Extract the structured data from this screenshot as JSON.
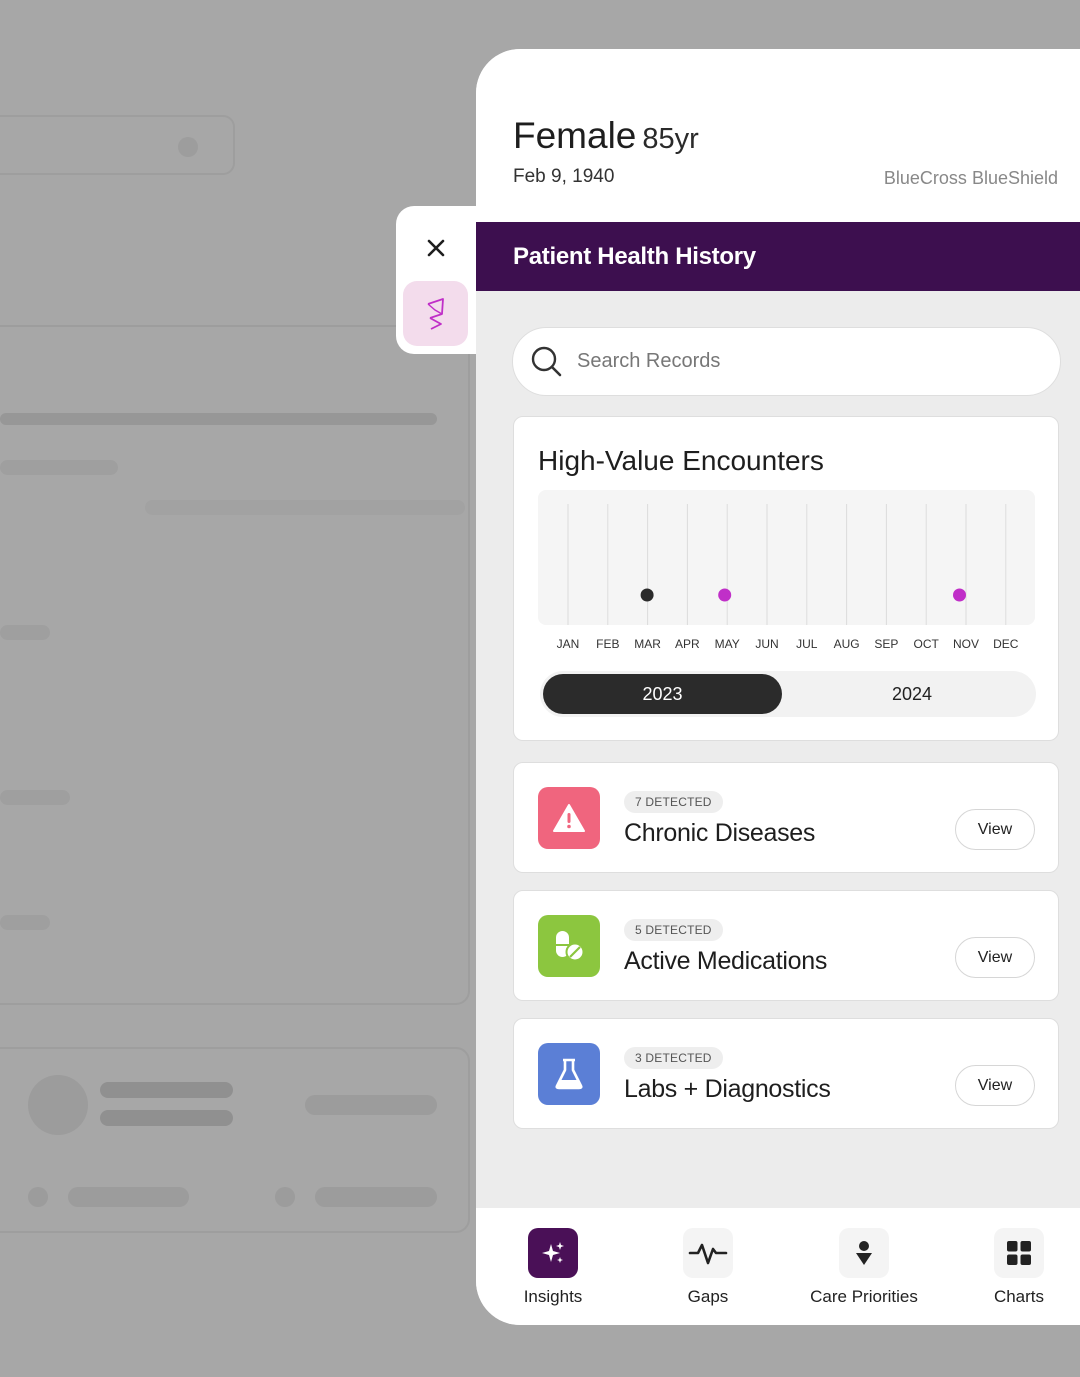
{
  "patient": {
    "gender": "Female",
    "age": "85yr",
    "dob": "Feb 9, 1940",
    "insurer": "BlueCross BlueShield"
  },
  "panel_title": "Patient Health History",
  "search": {
    "placeholder": "Search Records"
  },
  "encounters": {
    "title": "High-Value Encounters",
    "months": [
      "JAN",
      "FEB",
      "MAR",
      "APR",
      "MAY",
      "JUN",
      "JUL",
      "AUG",
      "SEP",
      "OCT",
      "NOV",
      "DEC"
    ],
    "points": [
      {
        "month": "MAR",
        "color": "#2b2b2b"
      },
      {
        "month": "MAY",
        "color": "#c02fc8"
      },
      {
        "month": "NOV",
        "color": "#c02fc8"
      }
    ],
    "years": [
      "2023",
      "2024"
    ],
    "selected_year": "2023"
  },
  "findings": [
    {
      "badge": "7 DETECTED",
      "name": "Chronic Diseases",
      "button": "View",
      "icon": "alert-triangle-icon",
      "color": "#f0657e"
    },
    {
      "badge": "5 DETECTED",
      "name": "Active Medications",
      "button": "View",
      "icon": "pill-icon",
      "color": "#8cc63f"
    },
    {
      "badge": "3 DETECTED",
      "name": "Labs + Diagnostics",
      "button": "View",
      "icon": "flask-icon",
      "color": "#5b7fd6"
    }
  ],
  "nav": [
    {
      "label": "Insights",
      "icon": "sparkle-icon",
      "active": true
    },
    {
      "label": "Gaps",
      "icon": "pulse-icon",
      "active": false
    },
    {
      "label": "Care Priorities",
      "icon": "person-priority-icon",
      "active": false
    },
    {
      "label": "Charts",
      "icon": "grid-icon",
      "active": false
    }
  ],
  "colors": {
    "brand": "#3d0f4f",
    "accent": "#c02fc8"
  }
}
